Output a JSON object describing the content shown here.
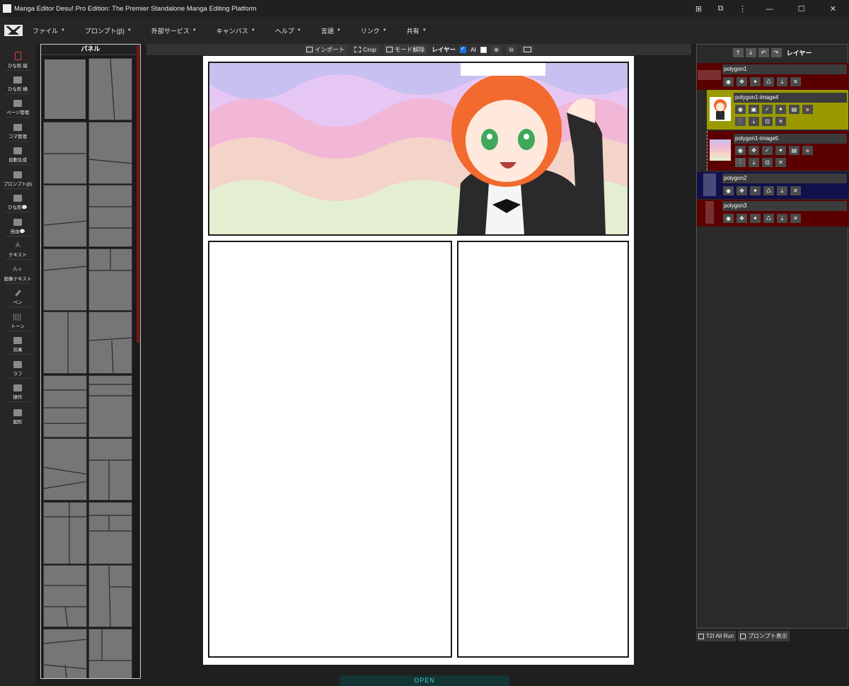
{
  "window": {
    "title": "Manga Editor Desu! Pro Edition: The Premier Standalone Manga Editing Platform",
    "controls": [
      "translate-icon",
      "extension-icon",
      "more-icon",
      "minimize-icon",
      "maximize-icon",
      "close-icon"
    ]
  },
  "menu": {
    "items": [
      {
        "label": "ファイル"
      },
      {
        "label": "プロンプト(β)"
      },
      {
        "label": "外部サービス"
      },
      {
        "label": "キャンバス"
      },
      {
        "label": "ヘルプ"
      },
      {
        "label": "言語"
      },
      {
        "label": "リンク"
      },
      {
        "label": "共有"
      }
    ]
  },
  "toolbar": {
    "tools": [
      {
        "label": "ひな形 縦",
        "icon": "portrait-template-icon",
        "active": true
      },
      {
        "label": "ひな形 横",
        "icon": "landscape-template-icon"
      },
      {
        "label": "ページ管理",
        "icon": "page-manage-icon"
      },
      {
        "label": "コマ管理",
        "icon": "panel-manage-icon"
      },
      {
        "label": "自動生成",
        "icon": "auto-generate-icon"
      },
      {
        "label": "プロンプト(β)",
        "icon": "prompt-icon"
      },
      {
        "label": "ひな形💬",
        "icon": "bubble-template-icon"
      },
      {
        "label": "自由💬",
        "icon": "free-bubble-icon"
      },
      {
        "label": "テキスト",
        "icon": "text-icon"
      },
      {
        "label": "画像テキスト",
        "icon": "image-text-icon"
      },
      {
        "label": "ペン",
        "icon": "pen-icon"
      },
      {
        "label": "トーン",
        "icon": "tone-icon"
      },
      {
        "label": "効果",
        "icon": "effect-icon"
      },
      {
        "label": "ラフ",
        "icon": "rough-icon"
      },
      {
        "label": "操作",
        "icon": "operation-icon"
      },
      {
        "label": "図形",
        "icon": "shape-icon"
      }
    ]
  },
  "palette": {
    "title": "パネル",
    "thumb_count": 20
  },
  "canvasbar": {
    "import_label": "インポート",
    "crop_label": "Crop",
    "mode_release_label": "モード解除",
    "layer_label": "レイヤー",
    "ai_label": "AI",
    "ai_checked": true,
    "extra_checked": false
  },
  "layers": {
    "title": "レイヤー",
    "rows": [
      {
        "name": "polygon1",
        "bg": "#5a0000",
        "swatch": "#7a3030"
      },
      {
        "name": "polygon1-image4",
        "bg": "#9a9a00",
        "thumb": "girl"
      },
      {
        "name": "polygon1-image5",
        "bg": "#5a0000",
        "thumb": "waves"
      },
      {
        "name": "polygon2",
        "bg": "#10104a",
        "swatch": "#4a4a7a"
      },
      {
        "name": "polygon3",
        "bg": "#5a0000",
        "swatch": "#7a3030"
      }
    ]
  },
  "bottom": {
    "t2i_label": "T2I All Run",
    "prompt_label": "プロンプト表示",
    "open_label": "OPEN"
  }
}
